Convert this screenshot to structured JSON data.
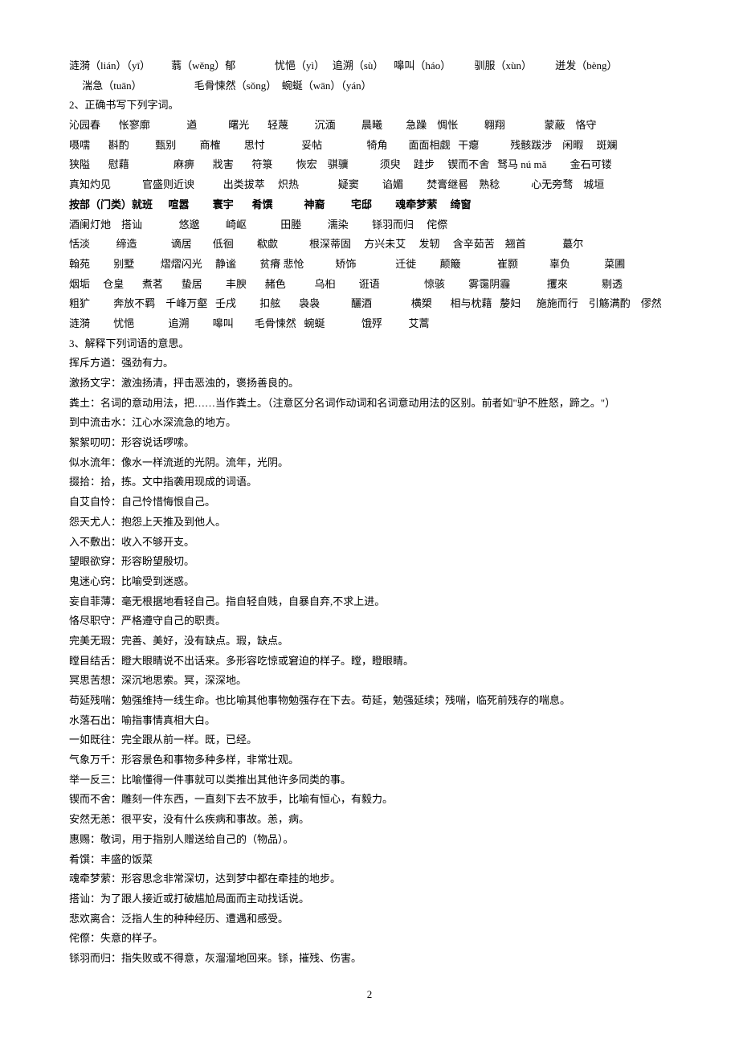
{
  "lines": [
    "涟漪（lián）（yī）        蓊（wěng）郁               忧悒（yì）   追溯（sù）    嗥叫（háo）         驯服（xùn）         迸发（bèng）",
    "     湍急（tuān）                    毛骨悚然（sǒng）  蜿蜒（wān）（yán）",
    "2、正确书写下列字词。",
    "沁园春       怅寥廓              遒            曙光       轻蔑          沉湎          晨曦         急躁    惆怅          翱翔               蒙蔽    恪守",
    "嗫嚅       斟酌          甄别         商榷         思忖              妥帖                 犄角        面面相觑   干瘪            残骸跋涉    闲暇     斑斓",
    "狭隘       慰藉                 麻痹       戕害       符箓         恢宏    骐骥            须臾     跬步     锲而不舍   驽马 nú mǎ         金石可镂",
    "真知灼见            官盛则近谀           出类拔萃     炽热               疑窦         谄媚         焚膏继晷    熟稔            心无旁骛    城垣"
  ],
  "lineBold": "按部（门类）就班      喧嚣         寰宇       肴馔            神裔          宅邸         魂牵梦萦     绮窗",
  "lines2": [
    "酒阑灯灺    搭讪              悠邈          崎岖             田塍          濡染         铩羽而归     侘傺",
    "恬淡          缔造             谪居        低徊         欷歔            根深蒂固     方兴未艾     发轫     含辛茹苦    翘首              蕞尔",
    "翰苑         别墅          熠熠闪光     静谧         贫瘠 悲怆            矫饰               迁徙         颠簸              崔颢            辜负             菜圃",
    "烟垢     仓皇       煮茗       蛰居         丰腴       赭色           乌桕         诳语                 惊骇         雾霭阴霾              攫來             剔透",
    "粗犷         奔放不羁    千峰万壑   壬戌         扣舷       袅袅            釃酒               横槊       相与枕藉   嫠妇      施施而行    引觞满酌    僇然",
    "涟漪         忧悒             追溯         嗥叫        毛骨悚然   蜿蜒              饿殍          艾蒿"
  ],
  "definitions": [
    "3、解释下列词语的意思。",
    "挥斥方遒：强劲有力。",
    "激扬文字：激浊扬清，抨击恶浊的，褒扬善良的。",
    "粪土：名词的意动用法，把……当作粪土。（注意区分名词作动词和名词意动用法的区别。前者如\"驴不胜怒，蹄之。\"）",
    "到中流击水：江心水深流急的地方。",
    "絮絮叨叨：形容说话啰嗦。",
    "似水流年：像水一样流逝的光阴。流年，光阴。",
    "掇拾：拾，拣。文中指袭用现成的词语。",
    "自艾自怜：自己怜惜悔恨自己。",
    "怨天尤人：抱怨上天推及到他人。",
    "入不敷出：收入不够开支。",
    "望眼欲穿：形容盼望殷切。",
    "鬼迷心窍：比喻受到迷惑。",
    "妄自菲薄：毫无根据地看轻自己。指自轻自贱，自暴自弃,不求上进。",
    "恪尽职守：严格遵守自己的职责。",
    "完美无瑕：完善、美好，没有缺点。瑕，缺点。",
    "瞠目结舌：瞪大眼睛说不出话来。多形容吃惊或窘迫的样子。瞠，瞪眼睛。",
    "冥思苦想：深沉地思索。冥，深深地。",
    "苟延残喘：勉强维持一线生命。也比喻其他事物勉强存在下去。苟延，勉强延续；残喘，临死前残存的喘息。",
    "水落石出：喻指事情真相大白。",
    "一如既往：完全跟从前一样。既，已经。",
    "气象万千：形容景色和事物多种多样，非常壮观。",
    "举一反三：比喻懂得一件事就可以类推出其他许多同类的事。",
    "锲而不舍：雕刻一件东西，一直刻下去不放手，比喻有恒心，有毅力。",
    "安然无恙：很平安，没有什么疾病和事故。恙，病。",
    "惠赐：敬词，用于指别人赠送给自己的（物品）。",
    "肴馔：丰盛的饭菜",
    "魂牵梦萦：形容思念非常深切，达到梦中都在牵挂的地步。",
    "搭讪：为了跟人接近或打破尴尬局面而主动找话说。",
    "悲欢离合：泛指人生的种种经历、遭遇和感受。",
    "侘傺：失意的样子。",
    "铩羽而归：指失败或不得意，灰溜溜地回来。铩，摧残、伤害。"
  ],
  "pageNumber": "2"
}
